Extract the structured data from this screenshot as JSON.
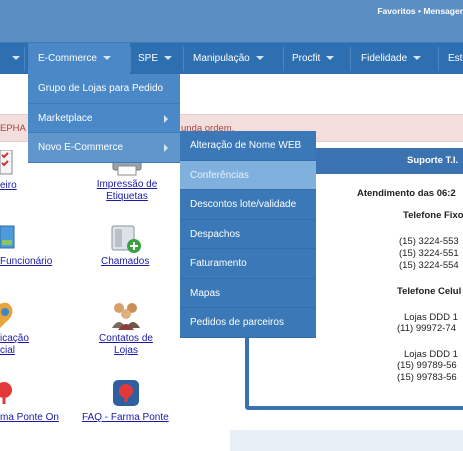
{
  "topbar": {
    "links": "Favoritos • Mensager"
  },
  "nav": {
    "items": [
      {
        "label": ""
      },
      {
        "label": "E-Commerce"
      },
      {
        "label": "SPE"
      },
      {
        "label": "Manipulação"
      },
      {
        "label": "Procfit"
      },
      {
        "label": "Fidelidade"
      },
      {
        "label": "Est"
      }
    ]
  },
  "ecommerce_menu": {
    "items": [
      {
        "label": "Grupo de Lojas para Pedido"
      },
      {
        "label": "Marketplace"
      },
      {
        "label": "Novo E-Commerce"
      }
    ]
  },
  "novo_menu": {
    "items": [
      {
        "label": "Alteração de Nome WEB"
      },
      {
        "label": "Conferências"
      },
      {
        "label": "Descontos lote/validade"
      },
      {
        "label": "Despachos"
      },
      {
        "label": "Faturamento"
      },
      {
        "label": "Mapas"
      },
      {
        "label": "Pedidos de parceiros"
      }
    ]
  },
  "alert": {
    "left_text": "EPHA",
    "right_text": "unda ordem."
  },
  "links": {
    "eiro": "eiro",
    "impressao": [
      "Impressão de",
      "Etiquetas"
    ],
    "funcionario": "Funcionário",
    "chamados": "Chamados",
    "icacao": [
      "icação",
      "cial"
    ],
    "contatos": [
      "Contatos de",
      "Lojas"
    ],
    "ponte_on": "ma Ponte On",
    "faq": "FAQ - Farma Ponte"
  },
  "support": {
    "title": "Suporte T.I.",
    "atendimento": "Atendimento das 06:2",
    "telefone_fixo": "Telefone Fixo",
    "fixo_numbers": [
      "(15) 3224-553",
      "(15) 3224-551",
      "(15) 3224-554"
    ],
    "telefone_celular": "Telefone Celul",
    "lojas_ddd_1": "Lojas DDD 1",
    "cel_1": "(11) 99972-74",
    "lojas_ddd_2": "Lojas DDD 1",
    "cel_2": [
      "(15) 99789-56",
      "(15) 99783-56"
    ]
  },
  "colors": {
    "navbar": "#2d6fb0",
    "topbar": "#5b8ec2",
    "menu": "#4a88c7",
    "submenu": "#3b78b7",
    "highlight": "#7fb0de",
    "alert_bg": "#f3dede",
    "link": "#1a1aa8"
  }
}
